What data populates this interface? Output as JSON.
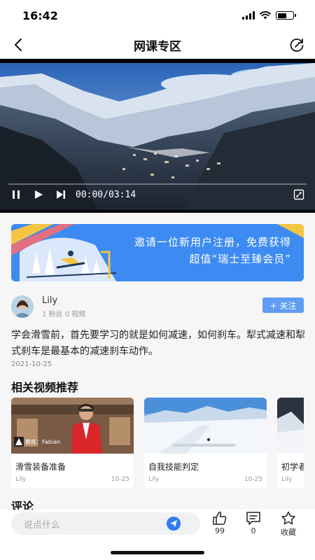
{
  "status_bar": {
    "time": "16:42",
    "battery_level": 0.6
  },
  "nav": {
    "title": "网课专区",
    "back_icon": "chevron-left-icon",
    "right_icon": "refresh-icon"
  },
  "video": {
    "time_display": "00:00/03:14",
    "progress": 0
  },
  "banner": {
    "line1": "邀请一位新用户注册，免费获得",
    "line2": "超值“瑞士至臻会员”"
  },
  "author": {
    "name": "Lily",
    "meta": "1 粉丝 0 视频",
    "follow_label": "+ 关注"
  },
  "post": {
    "description": "学会滑雪前，首先要学习的就是如何减速，如何刹车。犁式减速和犁式刹车是最基本的减速刹车动作。",
    "date": "2021-10-25"
  },
  "related": {
    "title": "相关视频推荐",
    "items": [
      {
        "title": "滑雪装备准备",
        "author": "Lily",
        "date": "10-25",
        "badge": "教练：Fabian"
      },
      {
        "title": "自我技能判定",
        "author": "Lily",
        "date": "10-25"
      },
      {
        "title": "初学者",
        "author": "Lily",
        "date": ""
      }
    ]
  },
  "comments": {
    "title": "评论"
  },
  "bottom": {
    "input_placeholder": "说点什么",
    "likes": "99",
    "comment_count": "0",
    "favorite_label": "收藏"
  },
  "colors": {
    "accent": "#2f7cf0",
    "follow": "#5f9cf2",
    "banner": "#3d8bf2"
  }
}
